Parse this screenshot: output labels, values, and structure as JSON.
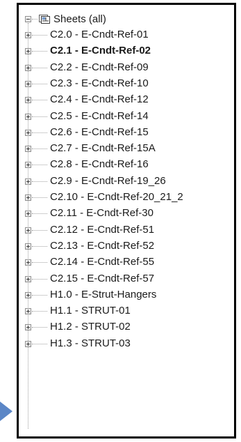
{
  "tree": {
    "root_label": "Sheets (all)",
    "root_icon": "sheets-icon",
    "items": [
      {
        "label": "C2.0 - E-Cndt-Ref-01",
        "bold": false
      },
      {
        "label": "C2.1 - E-Cndt-Ref-02",
        "bold": true
      },
      {
        "label": "C2.2 - E-Cndt-Ref-09",
        "bold": false
      },
      {
        "label": "C2.3 - E-Cndt-Ref-10",
        "bold": false
      },
      {
        "label": "C2.4 - E-Cndt-Ref-12",
        "bold": false
      },
      {
        "label": "C2.5 - E-Cndt-Ref-14",
        "bold": false
      },
      {
        "label": "C2.6 - E-Cndt-Ref-15",
        "bold": false
      },
      {
        "label": "C2.7 - E-Cndt-Ref-15A",
        "bold": false
      },
      {
        "label": "C2.8 - E-Cndt-Ref-16",
        "bold": false
      },
      {
        "label": "C2.9 - E-Cndt-Ref-19_26",
        "bold": false
      },
      {
        "label": "C2.10 - E-Cndt-Ref-20_21_2",
        "bold": false
      },
      {
        "label": "C2.11 - E-Cndt-Ref-30",
        "bold": false
      },
      {
        "label": "C2.12 - E-Cndt-Ref-51",
        "bold": false
      },
      {
        "label": "C2.13 - E-Cndt-Ref-52",
        "bold": false
      },
      {
        "label": "C2.14 - E-Cndt-Ref-55",
        "bold": false
      },
      {
        "label": "C2.15 - E-Cndt-Ref-57",
        "bold": false
      },
      {
        "label": "H1.0 - E-Strut-Hangers",
        "bold": false
      },
      {
        "label": "H1.1 - STRUT-01",
        "bold": false
      },
      {
        "label": "H1.2 - STRUT-02",
        "bold": false
      },
      {
        "label": "H1.3 - STRUT-03",
        "bold": false
      }
    ]
  },
  "colors": {
    "panel_border": "#000000",
    "arrow": "#5b86c6",
    "tree_lines": "#a0a0a0",
    "text": "#1a1a1a"
  }
}
